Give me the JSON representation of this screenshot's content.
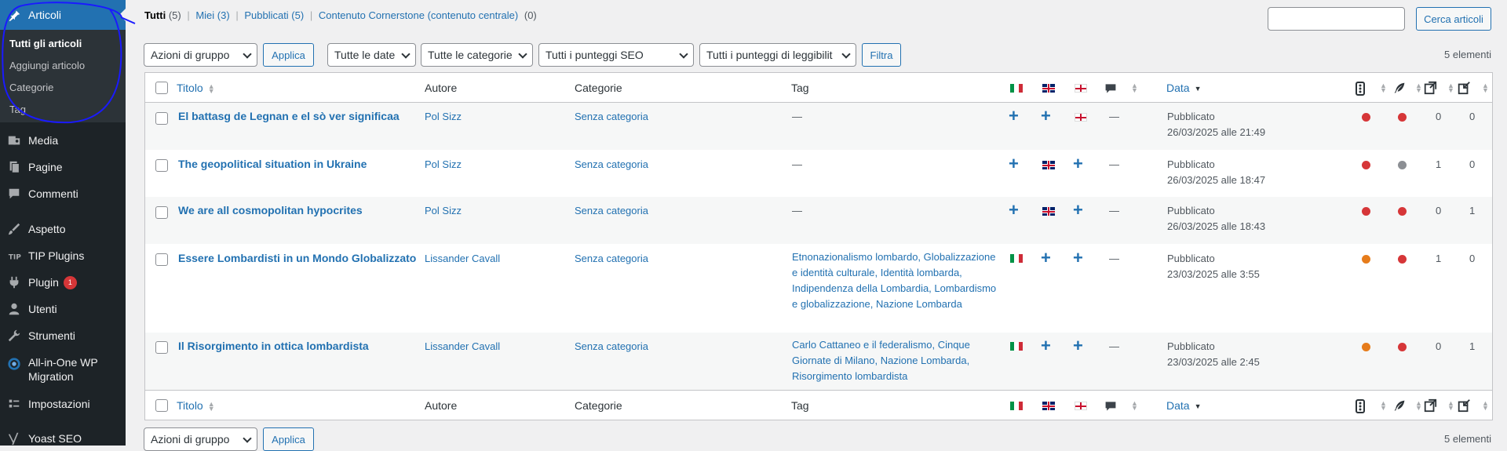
{
  "sidebar": {
    "items": [
      {
        "label": "Articoli",
        "icon": "pin-icon"
      },
      {
        "label": "Media",
        "icon": "media-icon"
      },
      {
        "label": "Pagine",
        "icon": "pages-icon"
      },
      {
        "label": "Commenti",
        "icon": "comments-icon"
      },
      {
        "label": "Aspetto",
        "icon": "brush-icon"
      },
      {
        "label": "TIP Plugins",
        "icon": "tip-icon"
      },
      {
        "label": "Plugin",
        "icon": "plugin-icon",
        "badge": "1"
      },
      {
        "label": "Utenti",
        "icon": "user-icon"
      },
      {
        "label": "Strumenti",
        "icon": "wrench-icon"
      },
      {
        "label": "All-in-One WP",
        "label2": "Migration",
        "icon": "migration-icon"
      },
      {
        "label": "Impostazioni",
        "icon": "settings-icon"
      },
      {
        "label": "Yoast SEO",
        "icon": "yoast-icon"
      }
    ],
    "submenu": [
      "Tutti gli articoli",
      "Aggiungi articolo",
      "Categorie",
      "Tag"
    ]
  },
  "views": {
    "all": "Tutti",
    "all_count": "(5)",
    "mine": "Miei (3)",
    "published": "Pubblicati (5)",
    "cornerstone": "Contenuto Cornerstone (contenuto centrale)",
    "cornerstone_count": "(0)",
    "sep": "|"
  },
  "search": {
    "button": "Cerca articoli"
  },
  "filters": {
    "bulk": "Azioni di gruppo",
    "apply": "Applica",
    "dates": "Tutte le date",
    "categories": "Tutte le categorie",
    "seo": "Tutti i punteggi SEO",
    "readability": "Tutti i punteggi di leggibilit",
    "filter": "Filtra"
  },
  "items_count": "5 elementi",
  "columns": {
    "title": "Titolo",
    "author": "Autore",
    "categories": "Categorie",
    "tags": "Tag",
    "date": "Data"
  },
  "rows": [
    {
      "title": "El battasg de Legnan e el sò ver significaa",
      "author": "Pol Sizz",
      "category": "Senza categoria",
      "tags": "—",
      "status": "Pubblicato",
      "date": "26/03/2025 alle 21:49",
      "lang_it": "plus",
      "lang_en": "plus",
      "lang_lmo": "flag",
      "comments": "—",
      "seo_color": "#d63638",
      "read_color": "#d63638",
      "links_in": "0",
      "links_out": "0"
    },
    {
      "title": "The geopolitical situation in Ukraine",
      "author": "Pol Sizz",
      "category": "Senza categoria",
      "tags": "—",
      "status": "Pubblicato",
      "date": "26/03/2025 alle 18:47",
      "lang_it": "plus",
      "lang_en": "flag",
      "lang_lmo": "plus",
      "comments": "—",
      "seo_color": "#d63638",
      "read_color": "#8c8f94",
      "links_in": "1",
      "links_out": "0"
    },
    {
      "title": "We are all cosmopolitan hypocrites",
      "author": "Pol Sizz",
      "category": "Senza categoria",
      "tags": "—",
      "status": "Pubblicato",
      "date": "26/03/2025 alle 18:43",
      "lang_it": "plus",
      "lang_en": "flag",
      "lang_lmo": "plus",
      "comments": "—",
      "seo_color": "#d63638",
      "read_color": "#d63638",
      "links_in": "0",
      "links_out": "1"
    },
    {
      "title": "Essere Lombardisti in un Mondo Globalizzato",
      "author": "Lissander Cavall",
      "category": "Senza categoria",
      "tags": "Etnonazionalismo lombardo, Globalizzazione e identità culturale, Identità lombarda, Indipendenza della Lombardia, Lombardismo e globalizzazione, Nazione Lombarda",
      "status": "Pubblicato",
      "date": "23/03/2025 alle 3:55",
      "lang_it": "flag",
      "lang_en": "plus",
      "lang_lmo": "plus",
      "comments": "—",
      "seo_color": "#e67c1b",
      "read_color": "#d63638",
      "links_in": "1",
      "links_out": "0"
    },
    {
      "title": "Il Risorgimento in ottica lombardista",
      "author": "Lissander Cavall",
      "category": "Senza categoria",
      "tags": "Carlo Cattaneo e il federalismo, Cinque Giornate di Milano, Nazione Lombarda, Risorgimento lombardista",
      "status": "Pubblicato",
      "date": "23/03/2025 alle 2:45",
      "lang_it": "flag",
      "lang_en": "plus",
      "lang_lmo": "plus",
      "comments": "—",
      "seo_color": "#e67c1b",
      "read_color": "#d63638",
      "links_in": "0",
      "links_out": "1"
    }
  ],
  "colors": {
    "accent": "#2271b1",
    "sidebar_bg": "#1d2327",
    "annotation": "#1a1aff"
  }
}
